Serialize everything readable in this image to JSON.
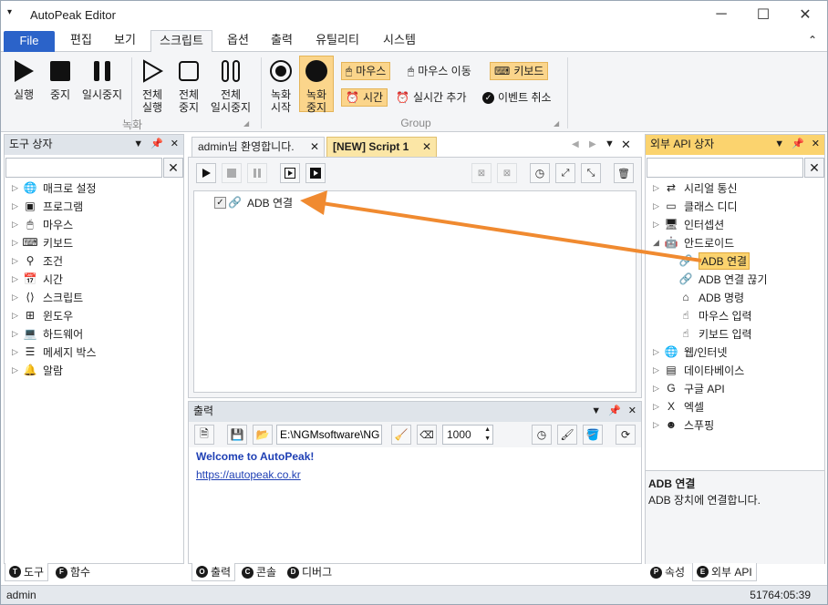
{
  "app": {
    "title": "AutoPeak Editor"
  },
  "window": {
    "minimize": "─",
    "maximize": "☐",
    "close": "✕"
  },
  "menu": {
    "file": "File",
    "tabs": [
      "편집",
      "보기",
      "스크립트",
      "옵션",
      "출력",
      "유틸리티",
      "시스템"
    ],
    "collapse": "⌃"
  },
  "ribbon": {
    "run": "실행",
    "stop": "중지",
    "pause": "일시중지",
    "all_run": "전체\n실행",
    "all_stop": "전체\n중지",
    "all_pause": "전체\n일시중지",
    "group_record": "녹화",
    "rec_start": "녹화\n시작",
    "rec_stop": "녹화\n중지",
    "mouse": "마우스",
    "mouse_move": "마우스 이동",
    "keyboard": "키보드",
    "time": "시간",
    "realtime_add": "실시간 추가",
    "event_cancel": "이벤트 취소",
    "group_group": "Group"
  },
  "left_panel": {
    "title": "도구 상자",
    "items": [
      {
        "label": "매크로 설정",
        "icon": "globe-gear-icon"
      },
      {
        "label": "프로그램",
        "icon": "program-icon"
      },
      {
        "label": "마우스",
        "icon": "mouse-icon"
      },
      {
        "label": "키보드",
        "icon": "keyboard-icon"
      },
      {
        "label": "조건",
        "icon": "condition-icon"
      },
      {
        "label": "시간",
        "icon": "calendar-icon",
        "badge": "31"
      },
      {
        "label": "스크립트",
        "icon": "script-icon"
      },
      {
        "label": "윈도우",
        "icon": "windows-icon"
      },
      {
        "label": "하드웨어",
        "icon": "laptop-icon"
      },
      {
        "label": "메세지 박스",
        "icon": "message-icon"
      },
      {
        "label": "알람",
        "icon": "bell-icon"
      }
    ],
    "tabs": [
      {
        "letter": "T",
        "label": "도구"
      },
      {
        "letter": "F",
        "label": "함수"
      }
    ]
  },
  "doc_tabs": [
    {
      "label": "admin님 환영합니다."
    },
    {
      "label": "[NEW] Script 1"
    }
  ],
  "script": {
    "items": [
      {
        "label": "ADB 연결",
        "checked": true
      }
    ]
  },
  "output": {
    "title": "출력",
    "path": "E:\\NGMsoftware\\NG",
    "count": "1000",
    "welcome": "Welcome to AutoPeak!",
    "link": "https://autopeak.co.kr",
    "tabs": [
      {
        "letter": "O",
        "label": "출력"
      },
      {
        "letter": "C",
        "label": "콘솔"
      },
      {
        "letter": "D",
        "label": "디버그"
      }
    ]
  },
  "right_panel": {
    "title": "외부 API 상자",
    "items": [
      {
        "label": "시리얼 통신",
        "icon": "serial-icon",
        "level": 0,
        "expanded": false
      },
      {
        "label": "클래스 디디",
        "icon": "class-icon",
        "level": 0,
        "expanded": false
      },
      {
        "label": "인터셉션",
        "icon": "monitor-icon",
        "level": 0,
        "expanded": false
      },
      {
        "label": "안드로이드",
        "icon": "android-icon",
        "level": 0,
        "expanded": true
      },
      {
        "label": "ADB 연결",
        "icon": "link-icon",
        "level": 1,
        "selected": true
      },
      {
        "label": "ADB 연결 끊기",
        "icon": "unlink-icon",
        "level": 1
      },
      {
        "label": "ADB 명령",
        "icon": "home-icon",
        "level": 1
      },
      {
        "label": "마우스 입력",
        "icon": "touch-icon",
        "level": 1
      },
      {
        "label": "키보드 입력",
        "icon": "touch-icon",
        "level": 1
      },
      {
        "label": "웹/인터넷",
        "icon": "web-icon",
        "level": 0,
        "expanded": false
      },
      {
        "label": "데이타베이스",
        "icon": "database-icon",
        "level": 0,
        "expanded": false
      },
      {
        "label": "구글 API",
        "icon": "google-icon",
        "level": 0,
        "expanded": false
      },
      {
        "label": "엑셀",
        "icon": "excel-icon",
        "level": 0,
        "expanded": false
      },
      {
        "label": "스푸핑",
        "icon": "mask-icon",
        "level": 0,
        "expanded": false
      }
    ],
    "desc_title": "ADB 연결",
    "desc_text": "ADB 장치에 연결합니다.",
    "tabs": [
      {
        "letter": "P",
        "label": "속성"
      },
      {
        "letter": "E",
        "label": "외부 API"
      }
    ]
  },
  "status": {
    "user": "admin",
    "time": "51764:05:39"
  },
  "colors": {
    "accent": "#2b63c9",
    "highlight": "#fbd36e",
    "arrow": "#f08a30",
    "link": "#1e3fb4"
  }
}
